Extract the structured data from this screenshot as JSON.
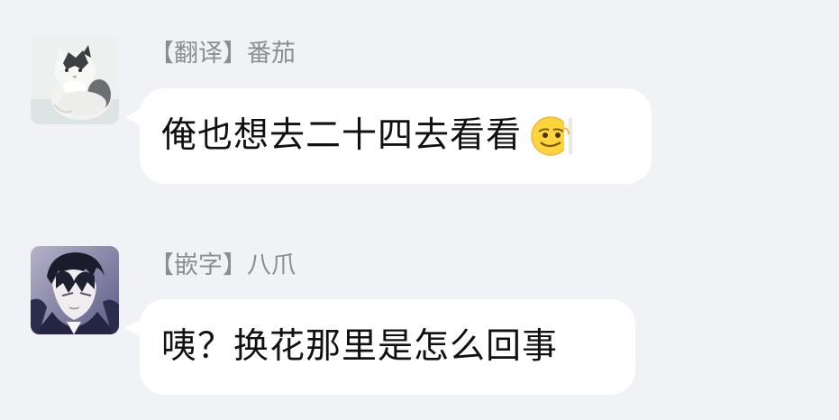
{
  "messages": [
    {
      "sender_tag": "【翻译】",
      "sender_name": "番茄",
      "text": "俺也想去二十四去看看",
      "avatar_icon": "cat-avatar",
      "emoji_icon": "peek-smile-emoji"
    },
    {
      "sender_tag": "【嵌字】",
      "sender_name": "八爪",
      "text": "咦？换花那里是怎么回事",
      "avatar_icon": "anime-character-avatar"
    }
  ],
  "colors": {
    "background": "#f1f2f5",
    "bubble": "#ffffff",
    "sender_text": "#8b8d93",
    "message_text": "#111111"
  }
}
